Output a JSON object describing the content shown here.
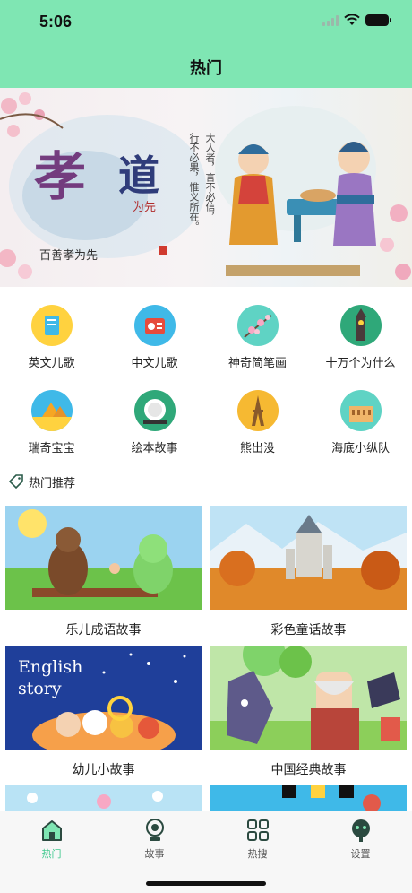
{
  "status_bar": {
    "time": "5:06"
  },
  "nav": {
    "title": "热门"
  },
  "banner": {
    "title_main": "孝",
    "title_second": "道",
    "title_small": "为先",
    "subtitle": "百善孝为先",
    "verse_col1": "大人者，言不必信，",
    "verse_col2": "行不必果，惟义所在。"
  },
  "categories": [
    {
      "label": "英文儿歌",
      "icon": "book-icon",
      "bg": "#ffd23f"
    },
    {
      "label": "中文儿歌",
      "icon": "radio-icon",
      "bg": "#3fb9e8"
    },
    {
      "label": "神奇简笔画",
      "icon": "blossom-icon",
      "bg": "#5fd3c4"
    },
    {
      "label": "十万个为什么",
      "icon": "clock-tower-icon",
      "bg": "#2fa879"
    },
    {
      "label": "瑞奇宝宝",
      "icon": "pyramid-icon",
      "bg": "#3fb9e8"
    },
    {
      "label": "绘本故事",
      "icon": "plate-icon",
      "bg": "#2fa879"
    },
    {
      "label": "熊出没",
      "icon": "eiffel-icon",
      "bg": "#f6b932"
    },
    {
      "label": "海底小纵队",
      "icon": "colosseum-icon",
      "bg": "#5fd3c4"
    }
  ],
  "section": {
    "title": "热门推荐"
  },
  "recommend": [
    {
      "caption": "乐儿成语故事"
    },
    {
      "caption": "彩色童话故事"
    },
    {
      "caption": "幼儿小故事",
      "overlay": "English story"
    },
    {
      "caption": "中国经典故事"
    }
  ],
  "tabs": [
    {
      "label": "热门",
      "icon": "home-icon",
      "active": true
    },
    {
      "label": "故事",
      "icon": "story-icon",
      "active": false
    },
    {
      "label": "热搜",
      "icon": "grid-icon",
      "active": false
    },
    {
      "label": "设置",
      "icon": "settings-icon",
      "active": false
    }
  ],
  "colors": {
    "header": "#7fe6b3",
    "accent": "#3fc98e"
  }
}
